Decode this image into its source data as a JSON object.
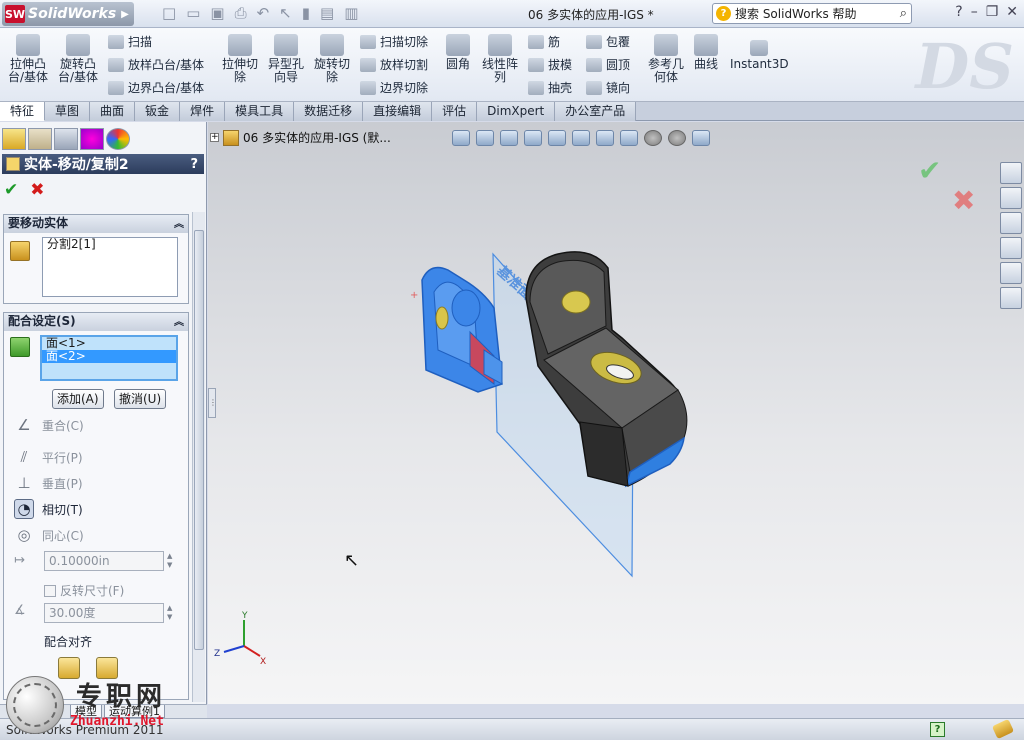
{
  "titlebar": {
    "app_name": "SolidWorks",
    "document_title": "06 多实体的应用-IGS *",
    "help_search": "搜索 SolidWorks 帮助",
    "window_controls": [
      "?",
      "–",
      "❐",
      "✕"
    ]
  },
  "ribbon": {
    "large_buttons": [
      {
        "label": "拉伸凸\n台/基体",
        "icon": "extruded-boss-icon"
      },
      {
        "label": "旋转凸\n台/基体",
        "icon": "revolved-boss-icon"
      },
      {
        "label": "拉伸切\n除",
        "icon": "extruded-cut-icon"
      },
      {
        "label": "异型孔\n向导",
        "icon": "hole-wizard-icon"
      },
      {
        "label": "旋转切\n除",
        "icon": "revolved-cut-icon"
      },
      {
        "label": "圆角",
        "icon": "fillet-icon"
      },
      {
        "label": "线性阵\n列",
        "icon": "linear-pattern-icon"
      },
      {
        "label": "参考几\n何体",
        "icon": "reference-geometry-icon"
      },
      {
        "label": "曲线",
        "icon": "curves-icon"
      },
      {
        "label": "Instant3D",
        "icon": "instant3d-icon"
      }
    ],
    "small_buttons": {
      "sweep": "扫描",
      "loft": "放样凸台/基体",
      "boundary_boss": "边界凸台/基体",
      "swept_cut": "扫描切除",
      "lofted_cut": "放样切割",
      "boundary_cut": "边界切除",
      "rib": "筋",
      "draft": "拔模",
      "shell": "抽壳",
      "wrap": "包覆",
      "dome": "圆顶",
      "mirror": "镜向"
    }
  },
  "command_tabs": [
    "特征",
    "草图",
    "曲面",
    "钣金",
    "焊件",
    "模具工具",
    "数据迁移",
    "直接编辑",
    "评估",
    "DimXpert",
    "办公室产品"
  ],
  "command_tabs_active": "特征",
  "property_manager": {
    "title": "实体-移动/复制2",
    "help": "?",
    "ok": "✔",
    "cancel": "✖",
    "bodies_group": {
      "title": "要移动实体",
      "items": [
        "分割2[1]"
      ]
    },
    "mate_group": {
      "title": "配合设定(S)",
      "faces": [
        "面<1>",
        "面<2>"
      ],
      "selected_face": "面<2>",
      "add_button": "添加(A)",
      "cancel_button": "撤消(U)",
      "mate_types": [
        {
          "label": "重合(C)",
          "icon": "coincident-icon",
          "glyph": "∠",
          "active": false
        },
        {
          "label": "平行(P)",
          "icon": "parallel-icon",
          "glyph": "⫽",
          "active": false
        },
        {
          "label": "垂直(P)",
          "icon": "perpendicular-icon",
          "glyph": "⊥",
          "active": false
        },
        {
          "label": "相切(T)",
          "icon": "tangent-icon",
          "glyph": "◔",
          "active": true
        },
        {
          "label": "同心(C)",
          "icon": "concentric-icon",
          "glyph": "◎",
          "active": false
        }
      ],
      "distance_value": "0.10000in",
      "flip_dimension": "反转尺寸(F)",
      "angle_value": "30.00度",
      "alignment_label": "配合对齐"
    }
  },
  "bottom_tabs": [
    "模型",
    "运动算例1"
  ],
  "status": {
    "text": "SolidWorks Premium 2011",
    "help_badge": "?"
  },
  "watermark": {
    "chinese": "专职网",
    "english": "Zhuanzhi.Net"
  },
  "viewport": {
    "tree_node": "06 多实体的应用-IGS  (默...",
    "plane_label": "基准面1",
    "triad": {
      "x": "X",
      "y": "Y",
      "z": "Z"
    }
  },
  "colors": {
    "accent": "#3399ff",
    "ok_green": "#1d9a2a",
    "cancel_red": "#d31b1b",
    "part_gray": "#4a4a4a",
    "selection_blue": "#2f7fe0"
  }
}
